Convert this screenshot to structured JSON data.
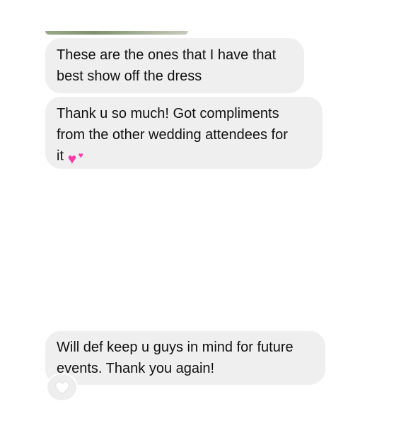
{
  "messages": [
    {
      "lines": [
        "These are the ones that I have that",
        "best show off the dress"
      ]
    },
    {
      "lines": [
        "Thank u so much! Got compliments",
        "from the other wedding attendees for",
        "it"
      ],
      "emoji": "two-hearts"
    },
    {
      "lines": [
        "Will def keep u guys in mind for future",
        "events. Thank you again!"
      ],
      "reaction": "white-heart"
    }
  ],
  "colors": {
    "bubble_background": "#efeff0",
    "text": "#111111",
    "heart_pink": "#ff3aa8",
    "reaction_heart": "#ffffff"
  }
}
